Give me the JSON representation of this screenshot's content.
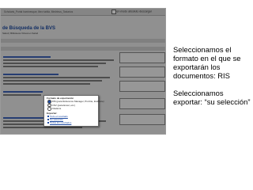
{
  "browser": {
    "tab_text": "Scholaris_Portal hominesque, libro·tablia, Medrinus_Taxiarios",
    "toolbar_label": "en modo absoluto descargar"
  },
  "page": {
    "heading": "de Búsqueda de la BVS",
    "subheading": "Salud | Biblioteca Virtual en Salud"
  },
  "dialog": {
    "section_format": "Formato de exportación",
    "format_option_ris": "RIS (para Reference Manager, ProCite, EndNote)",
    "format_option_csv": "CSV (para Excel, etc.)",
    "format_option_other": "Citations",
    "section_export": "Exportar:",
    "export_all": "Todo el resultado",
    "export_selection": "Su selección",
    "export_page": "Todos los resultados"
  },
  "instructions": {
    "line1": "Seleccionamos el formato en el que se exportarán los documentos: RIS",
    "line2": "Seleccionamos exportar: “su selección”"
  }
}
